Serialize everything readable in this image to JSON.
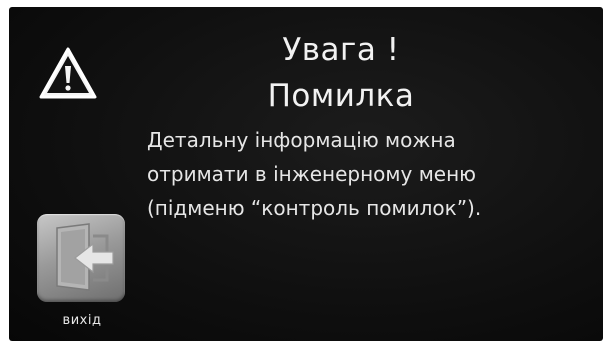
{
  "dialog": {
    "title_line1": "Увага !",
    "title_line2": "Помилка",
    "message_lines": [
      "Детальну інформацію можна",
      "отримати в інженерному меню",
      "(підменю “контроль помилок”)."
    ],
    "warning_icon": "warning-triangle-icon"
  },
  "exit_button": {
    "label": "вихід",
    "icon": "exit-door-icon"
  }
}
